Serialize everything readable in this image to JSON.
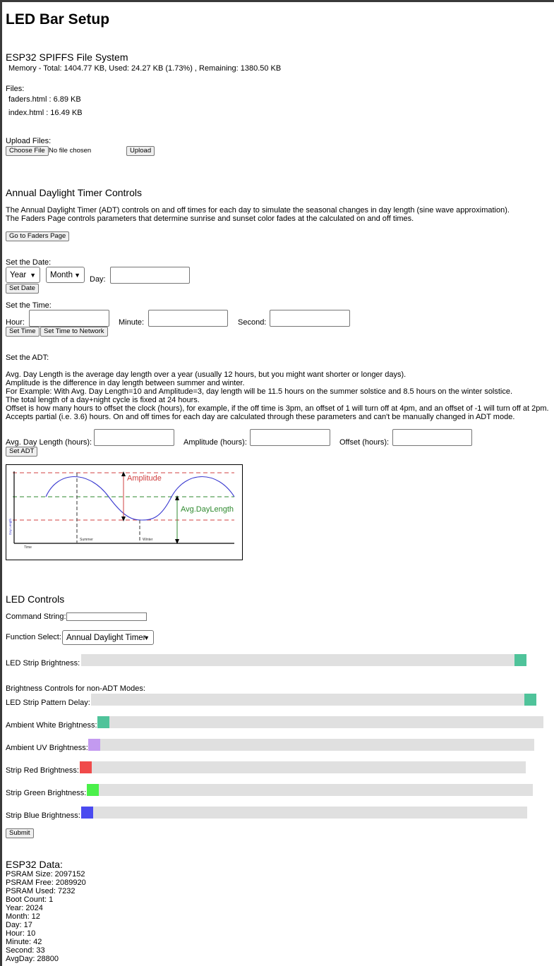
{
  "title": "LED Bar Setup",
  "fs": {
    "heading": "ESP32 SPIFFS File System",
    "memory": "Memory - Total: 1404.77 KB, Used: 24.27 KB (1.73%) , Remaining: 1380.50 KB",
    "files_label": "Files:",
    "files": [
      "faders.html : 6.89 KB",
      "index.html : 16.49 KB"
    ],
    "upload_label": "Upload Files:",
    "choose_file": "Choose File",
    "no_file": "No file chosen",
    "upload_button": "Upload"
  },
  "adt": {
    "heading": "Annual Daylight Timer Controls",
    "intro": [
      "The Annual Daylight Timer (ADT) controls on and off times for each day to simulate the seasonal changes in day length (sine wave approximation).",
      "The Faders Page controls parameters that determine sunrise and sunset color fades at the calculated on and off times."
    ],
    "faders_button": "Go to Faders Page",
    "date_label": "Set the Date:",
    "year_select": "Year",
    "month_select": "Month",
    "day_label": "Day:",
    "set_date_button": "Set Date",
    "time_label": "Set the Time:",
    "hour_label": "Hour:",
    "minute_label": "Minute:",
    "second_label": "Second:",
    "set_time_button": "Set Time",
    "set_time_network_button": "Set Time to Network",
    "set_adt_label": "Set the ADT:",
    "desc": [
      "Avg. Day Length is the average day length over a year (usually 12 hours, but you might want shorter or longer days).",
      "Amplitude is the difference in day length between summer and winter.",
      "For Example: With Avg. Day Length=10 and Amplitude=3, day length will be 11.5 hours on the summer solstice and 8.5 hours on the winter solstice.",
      "The total length of a day+night cycle is fixed at 24 hours.",
      "Offset is how many hours to offset the clock (hours), for example, if the off time is 3pm, an offset of 1 will turn off at 4pm, and an offset of -1 will turn off at 2pm.",
      "Accepts partial (i.e. 3.6) hours. On and off times for each day are calculated through these parameters and can't be manually changed in ADT mode."
    ],
    "avg_label": "Avg. Day Length (hours):",
    "amp_label": "Amplitude (hours):",
    "offset_label": "Offset (hours):",
    "set_adt_button": "Set ADT",
    "diagram": {
      "amplitude": "Amplitude",
      "avg_day_length": "Avg.DayLength",
      "summer": "Summer",
      "winter": "Winter",
      "time": "Time",
      "day_length": "Day Length"
    }
  },
  "led": {
    "heading": "LED Controls",
    "command_label": "Command String:",
    "function_label": "Function Select:",
    "function_value": "Annual Daylight Timer",
    "strip_brightness_label": "LED Strip Brightness:",
    "nonadt_label": "Brightness Controls for non-ADT Modes:",
    "pattern_delay_label": "LED Strip Pattern Delay:",
    "white_label": "Ambient White Brightness:",
    "uv_label": "Ambient UV Brightness:",
    "red_label": "Strip Red Brightness:",
    "green_label": "Strip Green Brightness:",
    "blue_label": "Strip Blue Brightness:",
    "submit_button": "Submit",
    "levels": {
      "strip_brightness": 1.0,
      "pattern_delay": 1.0,
      "white": 0.0,
      "uv": 0.0,
      "red": 0.0,
      "green": 0.0,
      "blue": 0.0
    },
    "colors": {
      "teal": "#4fc39a",
      "uv": "#c39af0",
      "red": "#f04a4a",
      "green": "#4af04a",
      "blue": "#4a4af0",
      "track": "#e0e0e0"
    }
  },
  "esp": {
    "heading": "ESP32 Data:",
    "lines": [
      "PSRAM Size: 2097152",
      "PSRAM Free: 2089920",
      "PSRAM Used: 7232",
      "Boot Count: 1",
      "Year: 2024",
      "Month: 12",
      "Day: 17",
      "Hour: 10",
      "Minute: 42",
      "Second: 33",
      "AvgDay: 28800"
    ]
  }
}
